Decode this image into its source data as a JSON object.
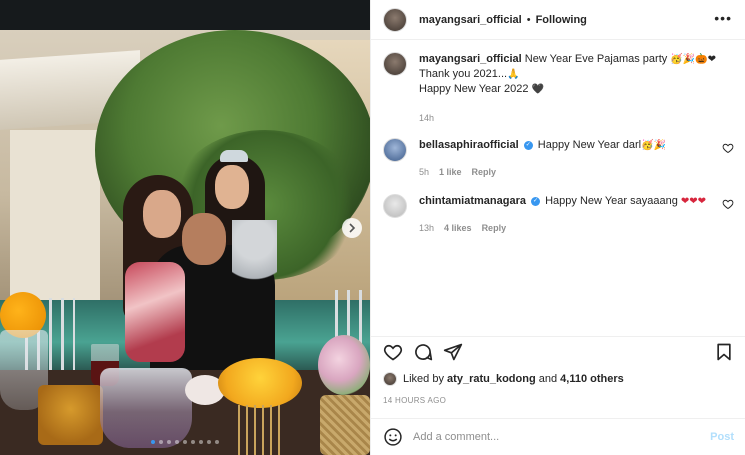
{
  "post": {
    "username": "mayangsari_official",
    "separator": "•",
    "follow_status": "Following",
    "more_icon": "more-horizontal-icon",
    "carousel_slides": 9,
    "carousel_active_index": 0
  },
  "caption": {
    "username": "mayangsari_official",
    "line1": "New Year Eve Pajamas party",
    "line1_emoji": "🥳🎉🎃❤",
    "line2": "Thank you 2021...",
    "line2_emoji": "🙏",
    "line3": "Happy New Year 2022",
    "line3_emoji": "🖤",
    "time": "14h"
  },
  "comments": [
    {
      "username": "bellasaphiraofficial",
      "verified": true,
      "text": "Happy New Year darl",
      "emoji": "🥳🎉",
      "time": "5h",
      "likes": "1 like",
      "reply": "Reply"
    },
    {
      "username": "chintamiatmanagara",
      "verified": true,
      "text": "Happy New Year sayaaang",
      "emoji": "❤❤❤",
      "time": "13h",
      "likes": "4 likes",
      "reply": "Reply"
    }
  ],
  "likes": {
    "prefix": "Liked by",
    "user": "aty_ratu_kodong",
    "and": "and",
    "others": "4,110 others"
  },
  "timestamp": "14 HOURS AGO",
  "add_comment": {
    "placeholder": "Add a comment...",
    "post_label": "Post"
  },
  "colors": {
    "link_blue": "#3897f0",
    "post_disabled": "#b2dffc",
    "heart_red": "#d7263d",
    "meta_gray": "#8e8e8e"
  }
}
